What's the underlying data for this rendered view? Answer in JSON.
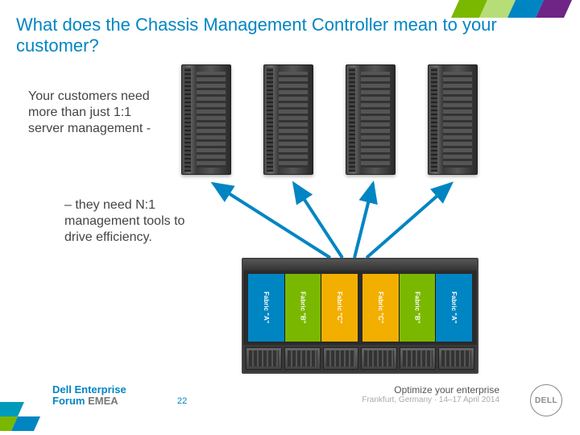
{
  "title": "What does the Chassis Management Controller mean to your customer?",
  "body1": "Your customers need more than just 1:1 server management -",
  "body2": "– they need N:1 management tools to drive efficiency.",
  "page_number": "22",
  "footer_left": {
    "line1": "Dell Enterprise",
    "line2_a": "Forum",
    "line2_b": " EMEA"
  },
  "footer_right": {
    "line1": "Optimize your enterprise",
    "line2": "Frankfurt, Germany · 14–17 April 2014"
  },
  "logo_text": "DELL",
  "fabric_labels": {
    "a": "Fabric \"A\"",
    "b": "Fabric \"B\"",
    "c": "Fabric \"C\""
  },
  "colors": {
    "brand_blue": "#0085c3",
    "green": "#7ab800",
    "yellow": "#f2af00"
  }
}
